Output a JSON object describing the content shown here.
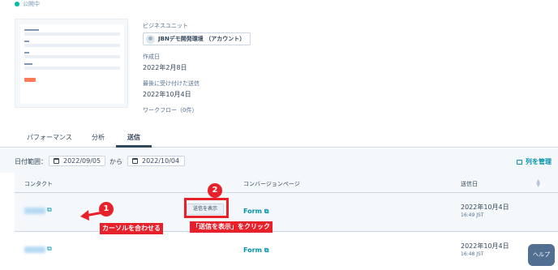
{
  "status": {
    "label": "公開中"
  },
  "meta": {
    "business_unit_label": "ビジネスユニット",
    "business_unit_value": "JBNデモ開発環境 （アカウント）",
    "created_label": "作成日",
    "created_value": "2022年2月8日",
    "last_submission_label": "最後に受け付けた送信",
    "last_submission_value": "2022年10月4日",
    "workflow_label": "ワークフロー（0件）"
  },
  "tabs": [
    {
      "label": "パフォーマンス"
    },
    {
      "label": "分析"
    },
    {
      "label": "送信"
    }
  ],
  "filter": {
    "label": "日付範囲：",
    "start": "2022/09/05",
    "connector": "から",
    "end": "2022/10/04",
    "manage_columns": "列を管理"
  },
  "table": {
    "headers": {
      "contact": "コンタクト",
      "conversion_page": "コンバージョンページ",
      "submitted": "送信日"
    },
    "rows": [
      {
        "show_button": "送信を表示",
        "page": "Form",
        "date": "2022年10月4日",
        "time": "16:49 JST"
      },
      {
        "page": "Form",
        "date": "2022年10月4日",
        "time": "16:48 JST"
      }
    ]
  },
  "annotations": {
    "step1_number": "1",
    "step1_text": "カーソルを合わせる",
    "step2_number": "2",
    "step2_text": "「送信を表示」をクリック",
    "accent_color": "#e8202a"
  },
  "help": {
    "label": "ヘルプ"
  }
}
